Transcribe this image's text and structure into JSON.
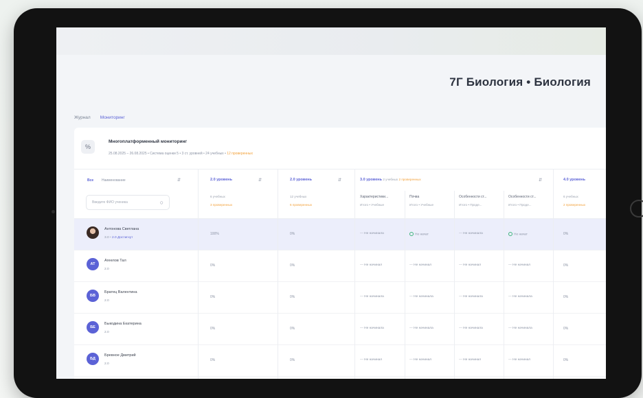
{
  "page": {
    "title": "7Г Биология • Биология",
    "tabs": [
      "Журнал",
      "Мониторинг"
    ]
  },
  "info": {
    "title": "Многоплатформенный мониторинг",
    "subtitle": "25.08.2025 – 26.08.2025 • Система оценки 5 • 3 ст. уровней • 24 учебных •",
    "subtitle_warn": "12 проверенных"
  },
  "table": {
    "header": {
      "all_label": "Все",
      "name_label": "Наименование",
      "search_placeholder": "Введите ФИО ученика",
      "columns": [
        {
          "level": "2.0 уровень",
          "sub1": "6 учебных",
          "sub2": "3 проверенных"
        },
        {
          "level": "2.0 уровень",
          "sub1": "12 учебных",
          "sub2": "6 проверенных"
        },
        {
          "level": "3.0 уровень",
          "inline_extra": "2 учебных",
          "inline_warn": "2 проверенных",
          "subcols": [
            {
              "name": "Характеристики...",
              "meta": "Итого • Учебные"
            },
            {
              "name": "Почва",
              "meta": "Итого • Учебные"
            },
            {
              "name": "Особенности ст...",
              "meta": "Итого • Проде..."
            },
            {
              "name": "Особенности ст...",
              "meta": "Итого • Проде..."
            }
          ]
        },
        {
          "level": "4.0 уровень",
          "sub1": "6 учебных",
          "sub2": "2 проверенных"
        }
      ]
    },
    "rows": [
      {
        "name": "Антонова Светлана",
        "initials": "",
        "meta": "3.0",
        "meta_link": "2.0 Достигнут",
        "c1": "100%",
        "c2": "0%",
        "states": [
          "Не начинала",
          "Не начат",
          "Не начинала",
          "Не начат"
        ],
        "done": [
          false,
          true,
          false,
          true
        ],
        "c4": "0%"
      },
      {
        "name": "Агеелов Тал",
        "initials": "АТ",
        "meta": "2.0",
        "meta_link": "",
        "c1": "0%",
        "c2": "0%",
        "states": [
          "Не начинал",
          "Не начинал",
          "Не начинал",
          "Не начинал"
        ],
        "done": [
          false,
          false,
          false,
          false
        ],
        "c4": "0%"
      },
      {
        "name": "Братец Валентина",
        "initials": "БВ",
        "meta": "2.0",
        "meta_link": "",
        "c1": "0%",
        "c2": "0%",
        "states": [
          "Не начинала",
          "Не начинала",
          "Не начинала",
          "Не начинала"
        ],
        "done": [
          false,
          false,
          false,
          false
        ],
        "c4": "0%"
      },
      {
        "name": "Быкодина Екатерина",
        "initials": "БЕ",
        "meta": "2.0",
        "meta_link": "",
        "c1": "0%",
        "c2": "0%",
        "states": [
          "Не начинала",
          "Не начинала",
          "Не начинала",
          "Не начинала"
        ],
        "done": [
          false,
          false,
          false,
          false
        ],
        "c4": "0%"
      },
      {
        "name": "Бревное Дмитрий",
        "initials": "БД",
        "meta": "2.0",
        "meta_link": "",
        "c1": "0%",
        "c2": "0%",
        "states": [
          "Не начинал",
          "Не начинал",
          "Не начинал",
          "Не начинал"
        ],
        "done": [
          false,
          false,
          false,
          false
        ],
        "c4": "0%"
      }
    ]
  },
  "icons": {
    "search": "search-icon",
    "info": "info-icon",
    "sort": "sort-icon",
    "check": "check-circle-icon"
  },
  "colors": {
    "accent": "#5b62d6",
    "warn": "#f2a13a",
    "ok": "#3cb37a",
    "highlight": "#eceefb"
  }
}
